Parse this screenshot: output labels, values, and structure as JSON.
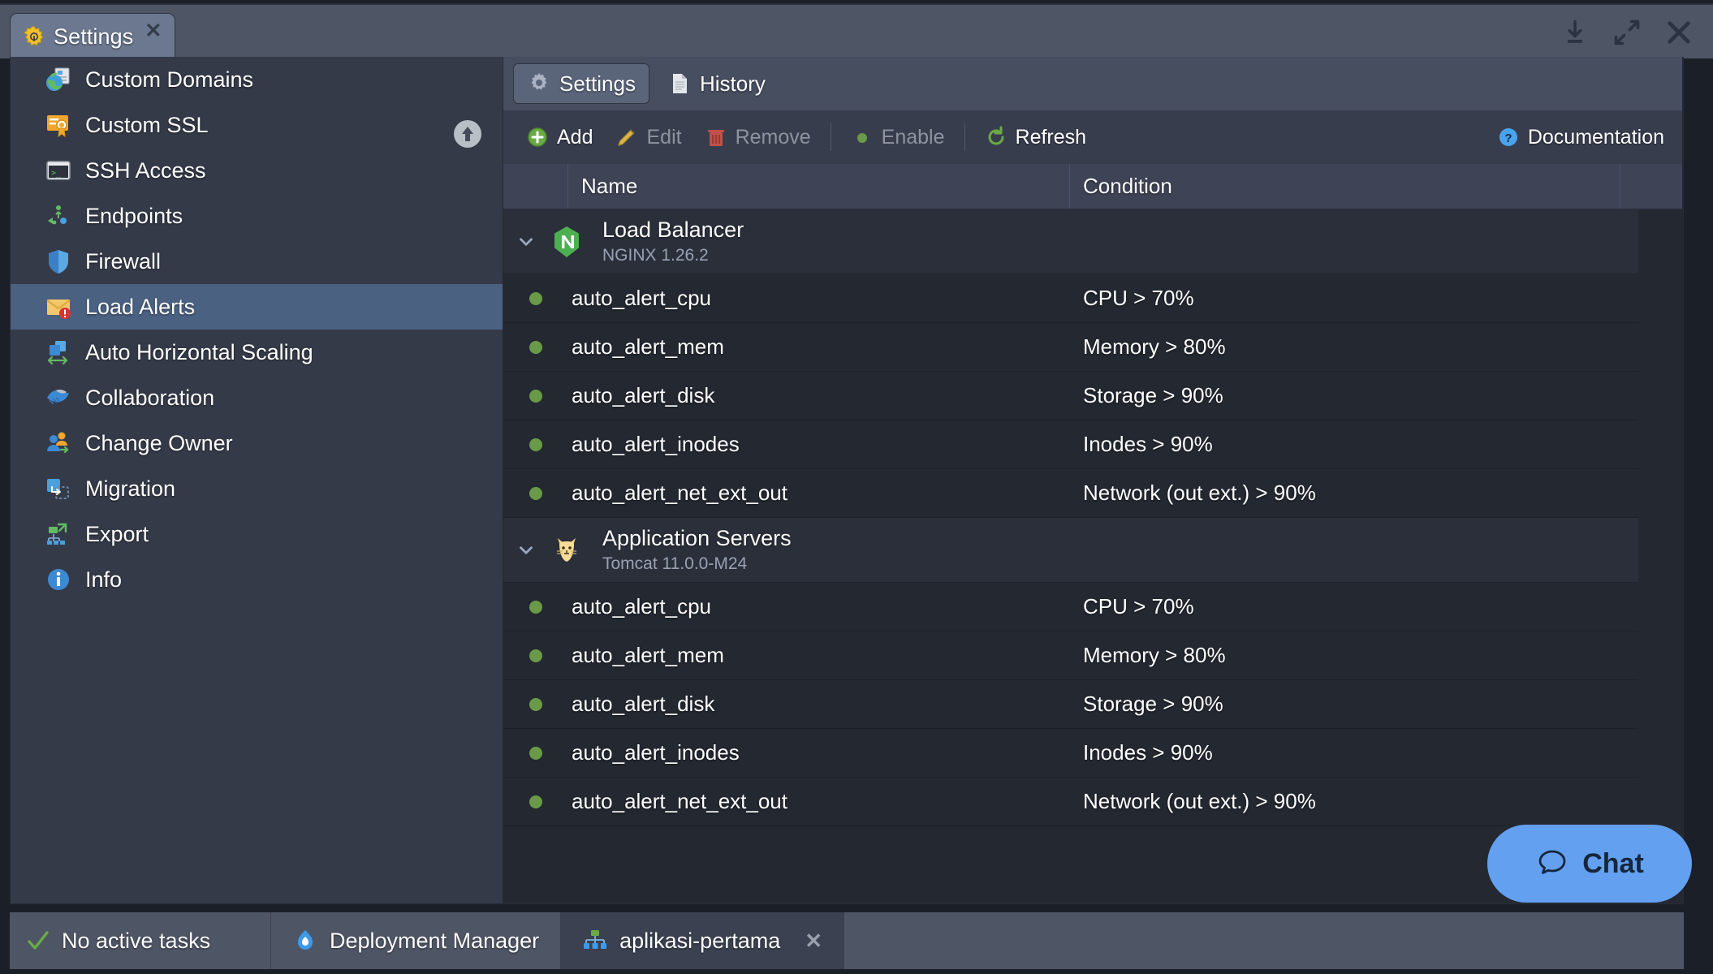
{
  "window": {
    "tab": {
      "label": "Settings",
      "icon": "gear-icon",
      "close": "✕"
    },
    "controls": [
      {
        "name": "minimize-to-tray-icon"
      },
      {
        "name": "expand-icon"
      },
      {
        "name": "close-icon"
      }
    ]
  },
  "sidebar": {
    "items": [
      {
        "label": "Custom Domains",
        "icon": "globe-page-icon",
        "selected": false
      },
      {
        "label": "Custom SSL",
        "icon": "certificate-icon",
        "selected": false
      },
      {
        "label": "SSH Access",
        "icon": "terminal-icon",
        "selected": false
      },
      {
        "label": "Endpoints",
        "icon": "endpoints-icon",
        "selected": false
      },
      {
        "label": "Firewall",
        "icon": "shield-icon",
        "selected": false
      },
      {
        "label": "Load Alerts",
        "icon": "mail-alert-icon",
        "selected": true
      },
      {
        "label": "Auto Horizontal Scaling",
        "icon": "horizontal-scaling-icon",
        "selected": false
      },
      {
        "label": "Collaboration",
        "icon": "handshake-icon",
        "selected": false
      },
      {
        "label": "Change Owner",
        "icon": "users-transfer-icon",
        "selected": false
      },
      {
        "label": "Migration",
        "icon": "migration-icon",
        "selected": false
      },
      {
        "label": "Export",
        "icon": "export-topology-icon",
        "selected": false
      },
      {
        "label": "Info",
        "icon": "info-icon",
        "selected": false
      }
    ],
    "scroll_up_button": "scroll-up-icon"
  },
  "main": {
    "tabs": [
      {
        "label": "Settings",
        "icon": "gear-icon",
        "active": true
      },
      {
        "label": "History",
        "icon": "document-icon",
        "active": false
      }
    ],
    "toolbar": [
      {
        "label": "Add",
        "icon": "plus-circle-icon",
        "disabled": false
      },
      {
        "label": "Edit",
        "icon": "pencil-icon",
        "disabled": true
      },
      {
        "label": "Remove",
        "icon": "trash-icon",
        "disabled": true
      },
      {
        "label": "Enable",
        "icon": "green-dot-icon",
        "disabled": true
      },
      {
        "label": "Refresh",
        "icon": "refresh-icon",
        "disabled": false
      }
    ],
    "documentation": {
      "label": "Documentation",
      "icon": "help-circle-icon"
    },
    "table": {
      "columns": [
        "Name",
        "Condition"
      ],
      "groups": [
        {
          "title": "Load Balancer",
          "subtitle": "NGINX 1.26.2",
          "icon": "nginx-icon",
          "expanded": true,
          "chevron": "chevron-down-icon",
          "rows": [
            {
              "status": "enabled",
              "name": "auto_alert_cpu",
              "condition": "CPU > 70%"
            },
            {
              "status": "enabled",
              "name": "auto_alert_mem",
              "condition": "Memory > 80%"
            },
            {
              "status": "enabled",
              "name": "auto_alert_disk",
              "condition": "Storage > 90%"
            },
            {
              "status": "enabled",
              "name": "auto_alert_inodes",
              "condition": "Inodes > 90%"
            },
            {
              "status": "enabled",
              "name": "auto_alert_net_ext_out",
              "condition": "Network (out ext.) > 90%"
            }
          ]
        },
        {
          "title": "Application Servers",
          "subtitle": "Tomcat 11.0.0-M24",
          "icon": "tomcat-icon",
          "expanded": true,
          "chevron": "chevron-down-icon",
          "rows": [
            {
              "status": "enabled",
              "name": "auto_alert_cpu",
              "condition": "CPU > 70%"
            },
            {
              "status": "enabled",
              "name": "auto_alert_mem",
              "condition": "Memory > 80%"
            },
            {
              "status": "enabled",
              "name": "auto_alert_disk",
              "condition": "Storage > 90%"
            },
            {
              "status": "enabled",
              "name": "auto_alert_inodes",
              "condition": "Inodes > 90%"
            },
            {
              "status": "enabled",
              "name": "auto_alert_net_ext_out",
              "condition": "Network (out ext.) > 90%"
            }
          ]
        }
      ]
    }
  },
  "chat": {
    "label": "Chat",
    "icon": "chat-bubble-icon"
  },
  "statusbar": {
    "tasks": {
      "label": "No active tasks",
      "icon": "check-icon"
    },
    "tabs": [
      {
        "label": "Deployment Manager",
        "icon": "deployment-manager-icon",
        "active": false,
        "closable": false
      },
      {
        "label": "aplikasi-pertama",
        "icon": "environment-icon",
        "active": true,
        "closable": true,
        "close": "✕"
      }
    ]
  },
  "colors": {
    "accent_selected": "#4a6181",
    "status_green": "#6a9a48",
    "chat_blue": "#64a0f0",
    "panel_bg": "#232831",
    "sidebar_bg": "#353a48",
    "titlebar_bg": "#4e5565"
  }
}
